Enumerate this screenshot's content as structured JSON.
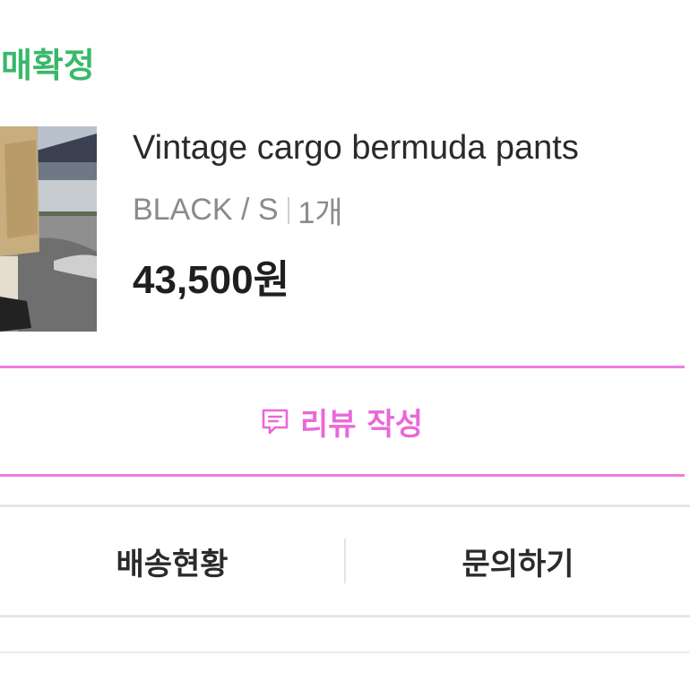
{
  "order": {
    "status_label": "구매확정"
  },
  "product": {
    "name": "Vintage cargo bermuda pants",
    "option": "BLACK / S",
    "quantity": "1개",
    "price": "43,500원",
    "thumbnail": "product-photo"
  },
  "review_button": {
    "label": "리뷰 작성",
    "icon": "review-icon",
    "color": "#ea68d8"
  },
  "actions": {
    "shipping_label": "배송현황",
    "inquiry_label": "문의하기"
  },
  "colors": {
    "status_green": "#39b86a",
    "review_pink": "#ee7de0"
  }
}
